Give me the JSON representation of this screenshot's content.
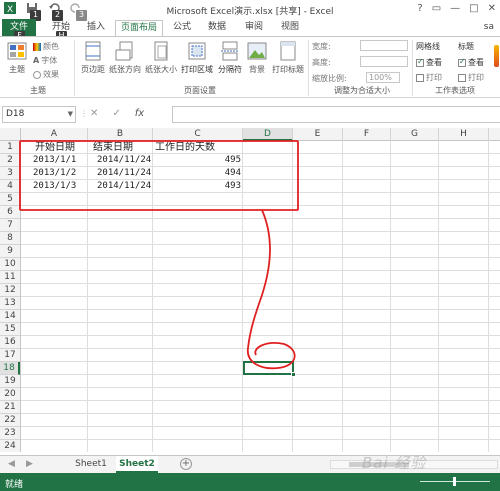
{
  "window": {
    "title": "Microsoft Excel演示.xlsx [共享] - Excel",
    "controls": [
      "?",
      "▭",
      "—",
      "□",
      "✕"
    ],
    "user": "sa"
  },
  "key_tips": [
    "1",
    "2",
    "3",
    "F",
    "H"
  ],
  "ribbon_tabs": [
    "文件",
    "开始",
    "插入",
    "页面布局",
    "公式",
    "数据",
    "审阅",
    "视图"
  ],
  "ribbon": {
    "theme_group": {
      "big_label": "主题",
      "colors": "颜色",
      "fonts": "字体",
      "effects": "效果",
      "group_label": "主题"
    },
    "page_setup": {
      "buttons": [
        "页边距",
        "纸张方向",
        "纸张大小",
        "打印区域",
        "分隔符",
        "背景",
        "打印标题"
      ],
      "group_label": "页面设置"
    },
    "scale": {
      "width_label": "宽度:",
      "height_label": "高度:",
      "scale_label": "缩放比例:",
      "scale_value": "100%",
      "group_label": "调整为合适大小"
    },
    "sheet_options": {
      "gridlines": "网格线",
      "headings": "标题",
      "view": "查看",
      "print": "打印",
      "group_label": "工作表选项"
    }
  },
  "formula_bar": {
    "name_box": "D18",
    "icons": [
      "✕",
      "✓",
      "fx"
    ],
    "value": ""
  },
  "columns": [
    "A",
    "B",
    "C",
    "D",
    "E",
    "F",
    "G",
    "H"
  ],
  "selected_column": "D",
  "rows": [
    "1",
    "2",
    "3",
    "4",
    "5",
    "6",
    "7",
    "8",
    "9",
    "10",
    "11",
    "12",
    "13",
    "14",
    "15",
    "16",
    "17",
    "18",
    "19",
    "20",
    "21",
    "22",
    "23",
    "24"
  ],
  "selected_row": "18",
  "table": {
    "headers": [
      "开始日期",
      "结束日期",
      "工作日的天数"
    ],
    "rows": [
      [
        "2013/1/1",
        "2014/11/24",
        "495"
      ],
      [
        "2013/1/2",
        "2014/11/24",
        "494"
      ],
      [
        "2013/1/3",
        "2014/11/24",
        "493"
      ]
    ]
  },
  "sheets": [
    "Sheet1",
    "Sheet2"
  ],
  "active_sheet": "Sheet2",
  "status": {
    "text": "就绪"
  },
  "watermark": "Bai 经验",
  "colors": {
    "excel_green": "#217346",
    "annotation_red": "#e02020"
  }
}
